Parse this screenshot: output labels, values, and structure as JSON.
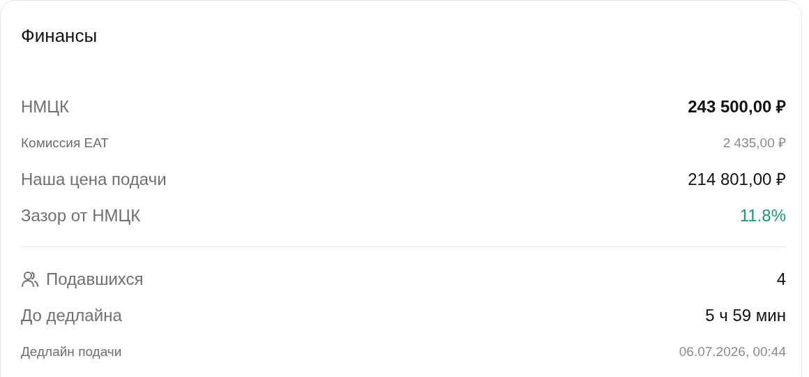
{
  "card": {
    "title": "Финансы"
  },
  "groups": [
    {
      "rows": [
        {
          "kind": "total",
          "label": "НМЦК",
          "value": "243 500,00 ₽"
        },
        {
          "kind": "minor",
          "label": "Комиссия ЕАТ",
          "value": "2 435,00 ₽"
        },
        {
          "kind": "regular",
          "label": "Наша цена подачи",
          "value": "214 801,00 ₽"
        },
        {
          "kind": "gain",
          "label": "Зазор от НМЦК",
          "value": "11.8%"
        }
      ]
    },
    {
      "rows": [
        {
          "kind": "participants",
          "label": "Подавшихся",
          "value": "4"
        },
        {
          "kind": "regular",
          "label": "До дедлайна",
          "value": "5 ч 59 мин"
        },
        {
          "kind": "minor",
          "label": "Дедлайн подачи",
          "value": "06.07.2026, 00:44"
        }
      ]
    }
  ]
}
